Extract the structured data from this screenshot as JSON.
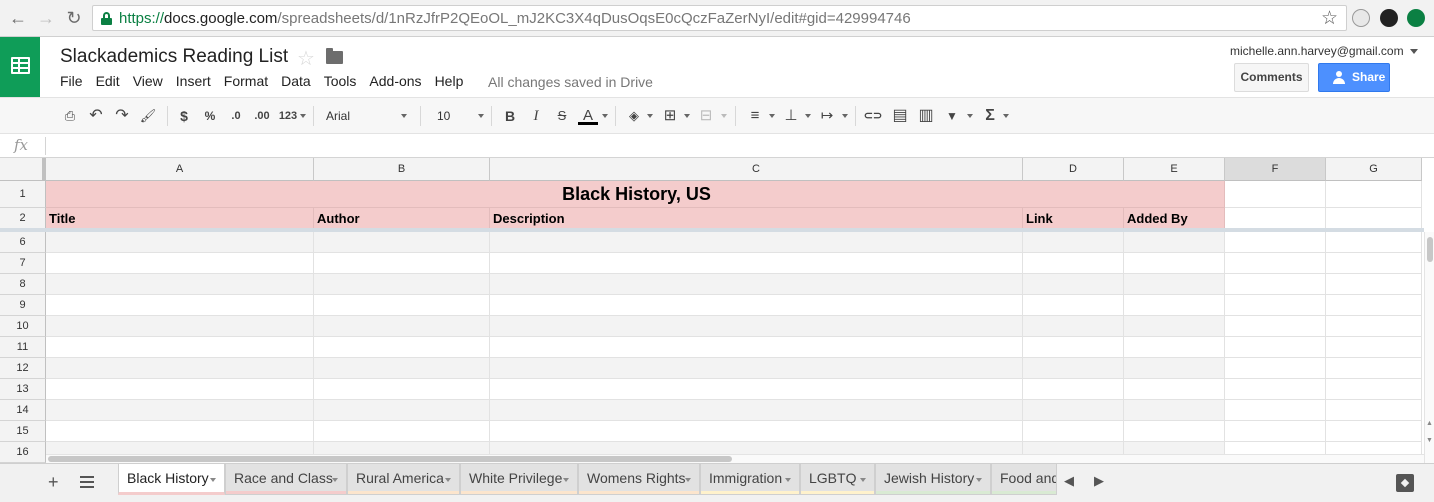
{
  "browser": {
    "url_scheme": "https://",
    "url_host": "docs.google.com",
    "url_path": "/spreadsheets/d/1nRzJfrP2QEoOL_mJ2KC3X4qDusOqsE0cQczFaZerNyI/edit#gid=429994746",
    "back_icon": "←",
    "forward_icon": "→",
    "reload_icon": "↻",
    "bookmark_icon": "☆"
  },
  "header": {
    "title": "Slackademics Reading List",
    "star_icon": "☆",
    "menus": [
      "File",
      "Edit",
      "View",
      "Insert",
      "Format",
      "Data",
      "Tools",
      "Add-ons",
      "Help"
    ],
    "saved_status": "All changes saved in Drive",
    "account_email": "michelle.ann.harvey@gmail.com",
    "comments_label": "Comments",
    "share_label": "Share"
  },
  "toolbar": {
    "print": "⎙",
    "undo": "↶",
    "redo": "↷",
    "paint_format": "🖌",
    "currency": "$",
    "percent": "%",
    "decrease_decimal": ".0",
    "increase_decimal": ".00",
    "more_formats": "123",
    "font": "Arial",
    "font_size": "10",
    "bold": "B",
    "italic": "I",
    "strikethrough": "S",
    "text_color": "A",
    "fill_color": "◈",
    "borders": "⊞",
    "merge": "⊟",
    "halign": "≡",
    "valign": "⊥",
    "wrap": "↦",
    "link": "⊂⊃",
    "comment": "▤",
    "chart": "▥",
    "filter": "▼",
    "functions": "Σ"
  },
  "formula_bar": {
    "fx_label": "fx",
    "value": ""
  },
  "grid": {
    "columns": [
      "A",
      "B",
      "C",
      "D",
      "E",
      "F",
      "G"
    ],
    "selected_column": "F",
    "rows": [
      "1",
      "2",
      "6",
      "7",
      "8",
      "9",
      "10",
      "11",
      "12",
      "13",
      "14",
      "15",
      "16"
    ],
    "title_cell": "Black History, US",
    "header_cells": [
      "Title",
      "Author",
      "Description",
      "Link",
      "Added By"
    ],
    "header_fill": "#f4cccc"
  },
  "sheets": {
    "add_icon": "+",
    "tabs": [
      {
        "name": "Black History",
        "color": "#f4cccc",
        "active": true
      },
      {
        "name": "Race and Class",
        "color": "#f4cccc",
        "active": false
      },
      {
        "name": "Rural America",
        "color": "#fce5cd",
        "active": false
      },
      {
        "name": "White Privilege",
        "color": "#fce5cd",
        "active": false
      },
      {
        "name": "Womens Rights",
        "color": "#fce5cd",
        "active": false
      },
      {
        "name": "Immigration",
        "color": "#fff2cc",
        "active": false
      },
      {
        "name": "LGBTQ",
        "color": "#fff2cc",
        "active": false
      },
      {
        "name": "Jewish History",
        "color": "#d9ead3",
        "active": false
      },
      {
        "name": "Food and",
        "color": "#d9ead3",
        "active": false
      }
    ],
    "prev_icon": "◀",
    "next_icon": "▶"
  }
}
